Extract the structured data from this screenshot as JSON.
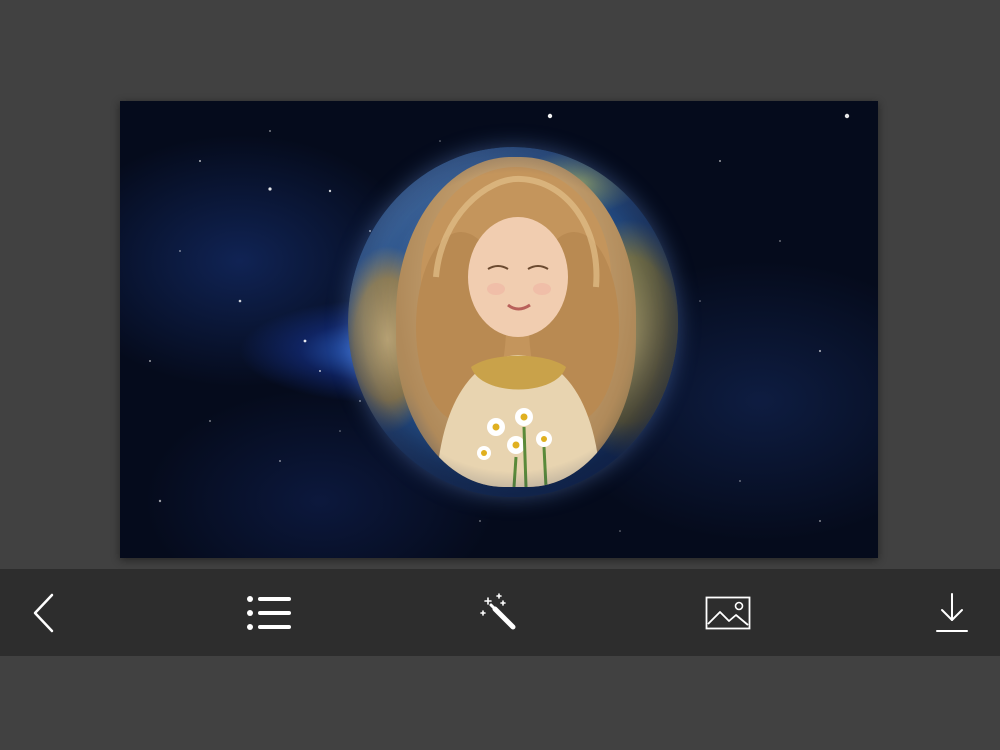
{
  "canvas": {
    "background": "galaxy-starfield",
    "content": "globe-photo-frame",
    "accent_color": "#3f7fff"
  },
  "toolbar": {
    "background_color": "#2d2d2d",
    "icon_color": "#ffffff",
    "items": [
      {
        "icon": "chevron-left-icon",
        "action": "back"
      },
      {
        "icon": "list-icon",
        "action": "frames"
      },
      {
        "icon": "magic-wand-icon",
        "action": "effects"
      },
      {
        "icon": "image-icon",
        "action": "gallery"
      },
      {
        "icon": "download-icon",
        "action": "save"
      }
    ]
  }
}
